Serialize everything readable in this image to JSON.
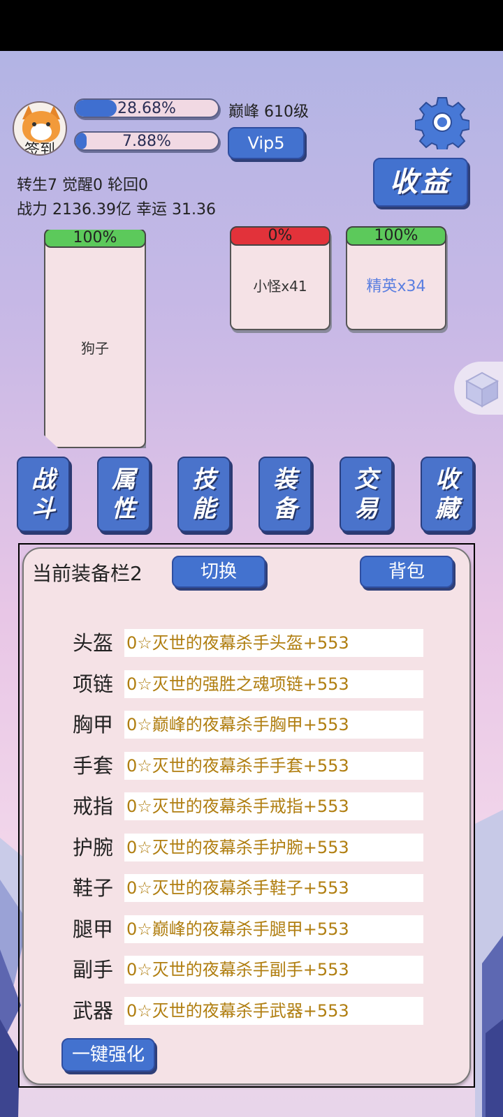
{
  "header": {
    "avatar_label": "签到",
    "exp_percent": 28.68,
    "exp_text": "28.68%",
    "peak_level": "巅峰 610级",
    "second_percent": 7.88,
    "second_text": "7.88%",
    "vip_label": "Vip5",
    "income_label": "收益",
    "stats_line1": "转生7 觉醒0 轮回0",
    "stats_line2": "战力 2136.39亿  幸运 31.36"
  },
  "battle": {
    "player": {
      "hp": "100%",
      "name": "狗子"
    },
    "minion": {
      "hp": "0%",
      "name": "小怪x41"
    },
    "elite": {
      "hp": "100%",
      "name": "精英x34"
    }
  },
  "nav": [
    {
      "line1": "战",
      "line2": "斗"
    },
    {
      "line1": "属",
      "line2": "性"
    },
    {
      "line1": "技",
      "line2": "能"
    },
    {
      "line1": "装",
      "line2": "备"
    },
    {
      "line1": "交",
      "line2": "易"
    },
    {
      "line1": "收",
      "line2": "藏"
    }
  ],
  "equipment": {
    "title": "当前装备栏2",
    "switch_label": "切换",
    "bag_label": "背包",
    "oneclick_label": "一键强化",
    "slots": [
      {
        "label": "头盔",
        "value": "0☆灭世的夜幕杀手头盔+553"
      },
      {
        "label": "项链",
        "value": "0☆灭世的强胜之魂项链+553"
      },
      {
        "label": "胸甲",
        "value": "0☆巅峰的夜幕杀手胸甲+553"
      },
      {
        "label": "手套",
        "value": "0☆灭世的夜幕杀手手套+553"
      },
      {
        "label": "戒指",
        "value": "0☆灭世的夜幕杀手戒指+553"
      },
      {
        "label": "护腕",
        "value": "0☆灭世的夜幕杀手护腕+553"
      },
      {
        "label": "鞋子",
        "value": "0☆灭世的夜幕杀手鞋子+553"
      },
      {
        "label": "腿甲",
        "value": "0☆巅峰的夜幕杀手腿甲+553"
      },
      {
        "label": "副手",
        "value": "0☆灭世的夜幕杀手副手+553"
      },
      {
        "label": "武器",
        "value": "0☆灭世的夜幕杀手武器+553"
      }
    ]
  },
  "colors": {
    "button_blue": "#4372cf",
    "hp_green": "#5cc95b",
    "hp_red": "#e2323a",
    "equip_gold": "#b07e10",
    "elite_blue": "#5a7ee0"
  }
}
